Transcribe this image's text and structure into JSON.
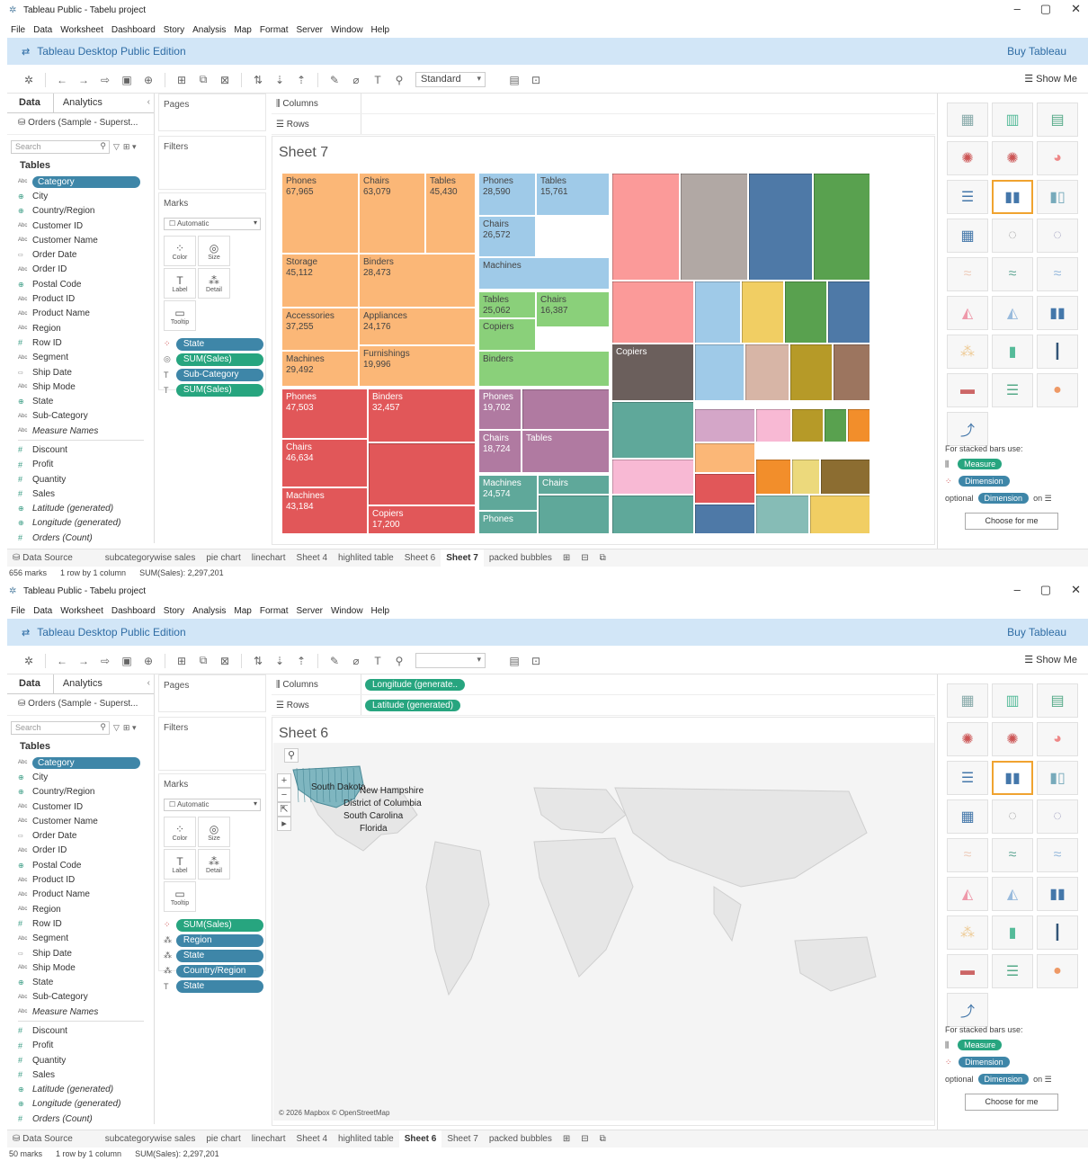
{
  "window": {
    "title": "Tableau Public - Tabelu project",
    "controls": [
      "–",
      "▢",
      "✕"
    ]
  },
  "menu": [
    "File",
    "Data",
    "Worksheet",
    "Dashboard",
    "Story",
    "Analysis",
    "Map",
    "Format",
    "Server",
    "Window",
    "Help"
  ],
  "banner": {
    "title": "Tableau Desktop Public Edition",
    "buy": "Buy Tableau"
  },
  "toolbar": {
    "mark_standard": "Standard",
    "show_me": "Show Me"
  },
  "left_tabs": {
    "data": "Data",
    "analytics": "Analytics"
  },
  "datasource": "Orders (Sample - Superst...",
  "search_placeholder": "Search",
  "tables_heading": "Tables",
  "fields": [
    {
      "name": "Category",
      "type": "Abc",
      "selected": true
    },
    {
      "name": "City",
      "type": "geo"
    },
    {
      "name": "Country/Region",
      "type": "geo"
    },
    {
      "name": "Customer ID",
      "type": "Abc"
    },
    {
      "name": "Customer Name",
      "type": "Abc"
    },
    {
      "name": "Order Date",
      "type": "date"
    },
    {
      "name": "Order ID",
      "type": "Abc"
    },
    {
      "name": "Postal Code",
      "type": "geo"
    },
    {
      "name": "Product ID",
      "type": "Abc"
    },
    {
      "name": "Product Name",
      "type": "Abc"
    },
    {
      "name": "Region",
      "type": "Abc"
    },
    {
      "name": "Row ID",
      "type": "num"
    },
    {
      "name": "Segment",
      "type": "Abc"
    },
    {
      "name": "Ship Date",
      "type": "date"
    },
    {
      "name": "Ship Mode",
      "type": "Abc"
    },
    {
      "name": "State",
      "type": "geo"
    },
    {
      "name": "Sub-Category",
      "type": "Abc"
    },
    {
      "name": "Measure Names",
      "type": "Abc",
      "italic": true
    },
    {
      "name": "Discount",
      "type": "mea"
    },
    {
      "name": "Profit",
      "type": "mea"
    },
    {
      "name": "Quantity",
      "type": "mea"
    },
    {
      "name": "Sales",
      "type": "mea"
    },
    {
      "name": "Latitude (generated)",
      "type": "geo",
      "italic": true
    },
    {
      "name": "Longitude (generated)",
      "type": "geo",
      "italic": true
    },
    {
      "name": "Orders (Count)",
      "type": "mea",
      "italic": true
    }
  ],
  "cards": {
    "pages": "Pages",
    "filters": "Filters",
    "marks": "Marks",
    "automatic": "Automatic"
  },
  "mark_buttons": [
    "Color",
    "Size",
    "Label",
    "Detail",
    "Tooltip"
  ],
  "shelves": {
    "columns": "Columns",
    "rows": "Rows"
  },
  "sheet_tabs": [
    "subcategorywise sales",
    "pie chart",
    "linechart",
    "Sheet 4",
    "highlited table",
    "Sheet 6",
    "Sheet 7",
    "packed bubbles"
  ],
  "data_source_tab": "Data Source",
  "show_me_panel": {
    "stacked_hint": "For stacked bars use:",
    "measure": "Measure",
    "dimension": "Dimension",
    "optional": "optional",
    "on": "on",
    "choose": "Choose for me"
  },
  "top": {
    "sheet_title": "Sheet 7",
    "active_tab": "Sheet 7",
    "marks_pills": [
      {
        "icon": "color",
        "label": "State",
        "kind": "b"
      },
      {
        "icon": "size",
        "label": "SUM(Sales)",
        "kind": "g"
      },
      {
        "icon": "label",
        "label": "Sub-Category",
        "kind": "b"
      },
      {
        "icon": "label",
        "label": "SUM(Sales)",
        "kind": "g"
      }
    ],
    "status": {
      "marks": "656 marks",
      "dims": "1 row by 1 column",
      "sum": "SUM(Sales): 2,297,201"
    },
    "treemap_labels": [
      {
        "name": "Phones",
        "value": "67,965"
      },
      {
        "name": "Chairs",
        "value": "63,079"
      },
      {
        "name": "Tables",
        "value": "45,430"
      },
      {
        "name": "Storage",
        "value": "45,112"
      },
      {
        "name": "Binders",
        "value": "28,473"
      },
      {
        "name": "Accessories",
        "value": "37,255"
      },
      {
        "name": "Appliances",
        "value": "24,176"
      },
      {
        "name": "Machines",
        "value": "29,492"
      },
      {
        "name": "Furnishings",
        "value": "19,996"
      },
      {
        "name": "Phones",
        "value": "28,590"
      },
      {
        "name": "Tables",
        "value": "15,761"
      },
      {
        "name": "Chairs",
        "value": "26,572"
      },
      {
        "name": "Machines",
        "value": ""
      },
      {
        "name": "Tables",
        "value": "25,062"
      },
      {
        "name": "Chairs",
        "value": "16,387"
      },
      {
        "name": "Copiers",
        "value": ""
      },
      {
        "name": "Binders",
        "value": ""
      },
      {
        "name": "Phones",
        "value": "47,503"
      },
      {
        "name": "Binders",
        "value": "32,457"
      },
      {
        "name": "Chairs",
        "value": "46,634"
      },
      {
        "name": "Machines",
        "value": "43,184"
      },
      {
        "name": "Copiers",
        "value": "17,200"
      },
      {
        "name": "Phones",
        "value": "19,702"
      },
      {
        "name": "Chairs",
        "value": "18,724"
      },
      {
        "name": "Tables",
        "value": ""
      },
      {
        "name": "Machines",
        "value": "24,574"
      },
      {
        "name": "Chairs",
        "value": ""
      },
      {
        "name": "Phones",
        "value": ""
      },
      {
        "name": "Copiers",
        "value": ""
      }
    ]
  },
  "bottom": {
    "sheet_title": "Sheet 6",
    "active_tab": "Sheet 6",
    "columns_pill": "Longitude (generate..",
    "rows_pill": "Latitude (generated)",
    "marks_pills": [
      {
        "icon": "color",
        "label": "SUM(Sales)",
        "kind": "g"
      },
      {
        "icon": "detail",
        "label": "Region",
        "kind": "b"
      },
      {
        "icon": "detail",
        "label": "State",
        "kind": "b"
      },
      {
        "icon": "detail",
        "label": "Country/Region",
        "kind": "b"
      },
      {
        "icon": "label",
        "label": "State",
        "kind": "b"
      }
    ],
    "status": {
      "marks": "50 marks",
      "dims": "1 row by 1 column",
      "sum": "SUM(Sales): 2,297,201"
    },
    "map_labels": [
      "South Dakota",
      "New Hampshire",
      "District of Columbia",
      "South Carolina",
      "Florida"
    ],
    "map_credit": "© 2026 Mapbox © OpenStreetMap"
  }
}
